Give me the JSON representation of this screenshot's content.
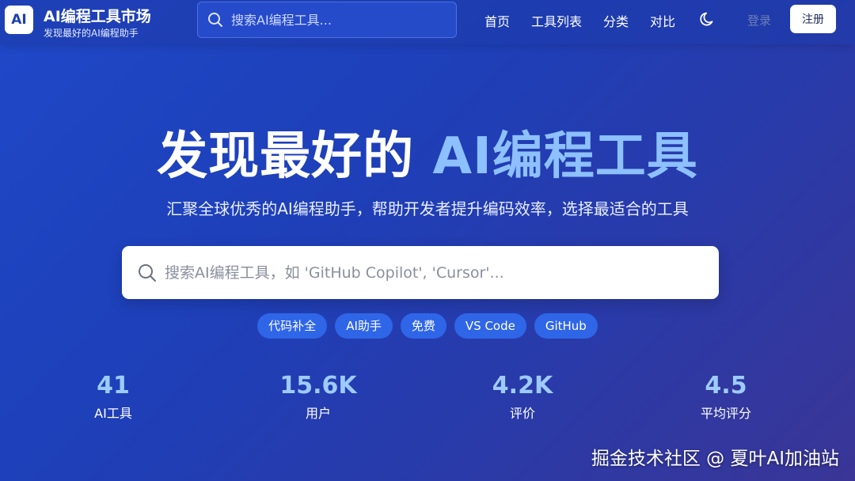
{
  "header": {
    "logo_text": "AI",
    "brand_title": "AI编程工具市场",
    "brand_subtitle": "发现最好的AI编程助手",
    "search_placeholder": "搜索AI编程工具...",
    "nav": [
      "首页",
      "工具列表",
      "分类",
      "对比"
    ],
    "theme_icon": "moon-icon",
    "login_label": "登录",
    "register_label": "注册"
  },
  "hero": {
    "title_prefix": "发现最好的",
    "title_highlight": "AI编程工具",
    "subtitle": "汇聚全球优秀的AI编程助手，帮助开发者提升编码效率，选择最适合的工具",
    "search_placeholder": "搜索AI编程工具，如 'GitHub Copilot', 'Cursor'...",
    "tags": [
      "代码补全",
      "AI助手",
      "免费",
      "VS Code",
      "GitHub"
    ]
  },
  "stats": [
    {
      "value": "41",
      "label": "AI工具"
    },
    {
      "value": "15.6K",
      "label": "用户"
    },
    {
      "value": "4.2K",
      "label": "评价"
    },
    {
      "value": "4.5",
      "label": "平均评分"
    }
  ],
  "watermark": "掘金技术社区 @ 夏叶AI加油站",
  "colors": {
    "background": "#1f48c8",
    "highlight": "#8dc0ff",
    "stat_number": "#9ecbff",
    "tag_bg": "#2f66e8"
  }
}
